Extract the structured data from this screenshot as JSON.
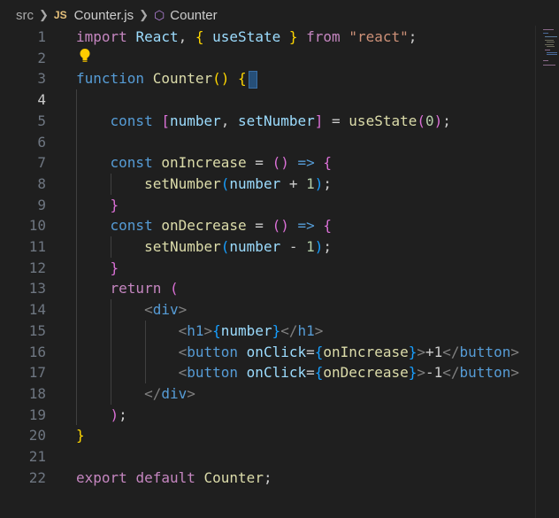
{
  "breadcrumb": {
    "folder": "src",
    "file_badge": "JS",
    "file": "Counter.js",
    "symbol": "Counter"
  },
  "editor": {
    "active_line": 4,
    "line_numbers": [
      "1",
      "2",
      "3",
      "4",
      "5",
      "6",
      "7",
      "8",
      "9",
      "10",
      "11",
      "12",
      "13",
      "14",
      "15",
      "16",
      "17",
      "18",
      "19",
      "20",
      "21",
      "22"
    ],
    "lines": [
      [
        [
          "kw",
          "import"
        ],
        [
          "pun",
          " "
        ],
        [
          "var",
          "React"
        ],
        [
          "pun",
          ", "
        ],
        [
          "br1",
          "{"
        ],
        [
          "pun",
          " "
        ],
        [
          "var",
          "useState"
        ],
        [
          "pun",
          " "
        ],
        [
          "br1",
          "}"
        ],
        [
          "pun",
          " "
        ],
        [
          "kw",
          "from"
        ],
        [
          "pun",
          " "
        ],
        [
          "str",
          "\"react\""
        ],
        [
          "pun",
          ";"
        ]
      ],
      [],
      [
        [
          "stor",
          "function"
        ],
        [
          "pun",
          " "
        ],
        [
          "fn",
          "Counter"
        ],
        [
          "br1",
          "()"
        ],
        [
          "pun",
          " "
        ],
        [
          "br1",
          "{"
        ]
      ],
      [],
      [
        [
          "pun",
          "    "
        ],
        [
          "stor",
          "const"
        ],
        [
          "pun",
          " "
        ],
        [
          "br2",
          "["
        ],
        [
          "var",
          "number"
        ],
        [
          "pun",
          ", "
        ],
        [
          "var",
          "setNumber"
        ],
        [
          "br2",
          "]"
        ],
        [
          "pun",
          " = "
        ],
        [
          "fn",
          "useState"
        ],
        [
          "br2",
          "("
        ],
        [
          "num",
          "0"
        ],
        [
          "br2",
          ")"
        ],
        [
          "pun",
          ";"
        ]
      ],
      [],
      [
        [
          "pun",
          "    "
        ],
        [
          "stor",
          "const"
        ],
        [
          "pun",
          " "
        ],
        [
          "fn",
          "onIncrease"
        ],
        [
          "pun",
          " = "
        ],
        [
          "br2",
          "()"
        ],
        [
          "pun",
          " "
        ],
        [
          "stor",
          "=>"
        ],
        [
          "pun",
          " "
        ],
        [
          "br2",
          "{"
        ]
      ],
      [
        [
          "pun",
          "        "
        ],
        [
          "fn",
          "setNumber"
        ],
        [
          "br3",
          "("
        ],
        [
          "var",
          "number"
        ],
        [
          "pun",
          " + "
        ],
        [
          "num",
          "1"
        ],
        [
          "br3",
          ")"
        ],
        [
          "pun",
          ";"
        ]
      ],
      [
        [
          "pun",
          "    "
        ],
        [
          "br2",
          "}"
        ]
      ],
      [
        [
          "pun",
          "    "
        ],
        [
          "stor",
          "const"
        ],
        [
          "pun",
          " "
        ],
        [
          "fn",
          "onDecrease"
        ],
        [
          "pun",
          " = "
        ],
        [
          "br2",
          "()"
        ],
        [
          "pun",
          " "
        ],
        [
          "stor",
          "=>"
        ],
        [
          "pun",
          " "
        ],
        [
          "br2",
          "{"
        ]
      ],
      [
        [
          "pun",
          "        "
        ],
        [
          "fn",
          "setNumber"
        ],
        [
          "br3",
          "("
        ],
        [
          "var",
          "number"
        ],
        [
          "pun",
          " - "
        ],
        [
          "num",
          "1"
        ],
        [
          "br3",
          ")"
        ],
        [
          "pun",
          ";"
        ]
      ],
      [
        [
          "pun",
          "    "
        ],
        [
          "br2",
          "}"
        ]
      ],
      [
        [
          "pun",
          "    "
        ],
        [
          "kw",
          "return"
        ],
        [
          "pun",
          " "
        ],
        [
          "br2",
          "("
        ]
      ],
      [
        [
          "pun",
          "        "
        ],
        [
          "gray",
          "<"
        ],
        [
          "tag",
          "div"
        ],
        [
          "gray",
          ">"
        ]
      ],
      [
        [
          "pun",
          "            "
        ],
        [
          "gray",
          "<"
        ],
        [
          "tag",
          "h1"
        ],
        [
          "gray",
          ">"
        ],
        [
          "br3",
          "{"
        ],
        [
          "var",
          "number"
        ],
        [
          "br3",
          "}"
        ],
        [
          "gray",
          "</"
        ],
        [
          "tag",
          "h1"
        ],
        [
          "gray",
          ">"
        ]
      ],
      [
        [
          "pun",
          "            "
        ],
        [
          "gray",
          "<"
        ],
        [
          "tag",
          "button"
        ],
        [
          "pun",
          " "
        ],
        [
          "attr",
          "onClick"
        ],
        [
          "pun",
          "="
        ],
        [
          "br3",
          "{"
        ],
        [
          "fn",
          "onIncrease"
        ],
        [
          "br3",
          "}"
        ],
        [
          "gray",
          ">"
        ],
        [
          "pun",
          "+1"
        ],
        [
          "gray",
          "</"
        ],
        [
          "tag",
          "button"
        ],
        [
          "gray",
          ">"
        ]
      ],
      [
        [
          "pun",
          "            "
        ],
        [
          "gray",
          "<"
        ],
        [
          "tag",
          "button"
        ],
        [
          "pun",
          " "
        ],
        [
          "attr",
          "onClick"
        ],
        [
          "pun",
          "="
        ],
        [
          "br3",
          "{"
        ],
        [
          "fn",
          "onDecrease"
        ],
        [
          "br3",
          "}"
        ],
        [
          "gray",
          ">"
        ],
        [
          "pun",
          "-1"
        ],
        [
          "gray",
          "</"
        ],
        [
          "tag",
          "button"
        ],
        [
          "gray",
          ">"
        ]
      ],
      [
        [
          "pun",
          "        "
        ],
        [
          "gray",
          "</"
        ],
        [
          "tag",
          "div"
        ],
        [
          "gray",
          ">"
        ]
      ],
      [
        [
          "pun",
          "    "
        ],
        [
          "br2",
          ")"
        ],
        [
          "pun",
          ";"
        ]
      ],
      [
        [
          "br1",
          "}"
        ]
      ],
      [],
      [
        [
          "kw",
          "export"
        ],
        [
          "pun",
          " "
        ],
        [
          "kw",
          "default"
        ],
        [
          "pun",
          " "
        ],
        [
          "fn",
          "Counter"
        ],
        [
          "pun",
          ";"
        ]
      ]
    ]
  },
  "icons": {
    "chevron": "chevron-right-icon",
    "symbol": "symbol-class-icon",
    "lightbulb": "lightbulb-icon"
  },
  "colors": {
    "background": "#1f1f1f",
    "keyword": "#c586c0",
    "storage": "#569cd6",
    "variable": "#9cdcfe",
    "function": "#dcdcaa",
    "string": "#ce9178",
    "number": "#b5cea8",
    "bracket_level1": "#ffd700",
    "bracket_level2": "#da70d6",
    "bracket_level3": "#179fff"
  }
}
